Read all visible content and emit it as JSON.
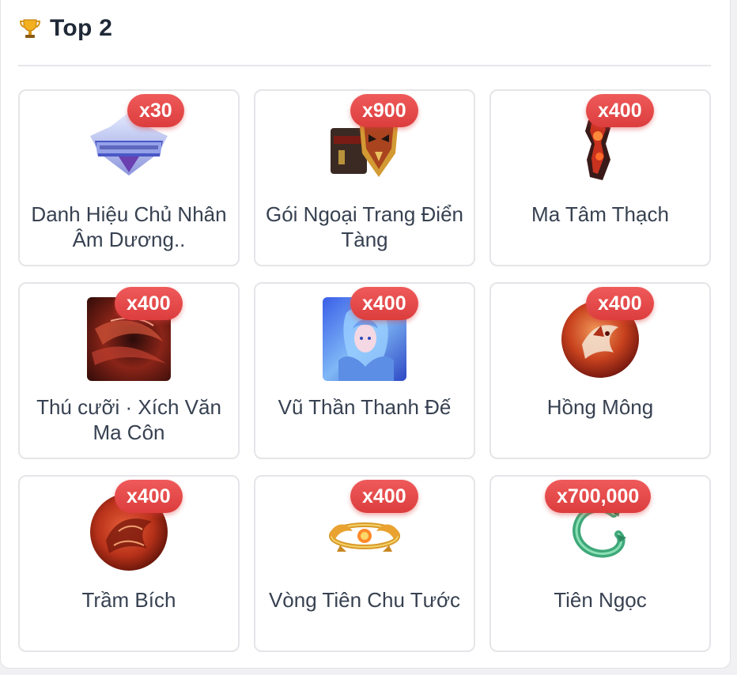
{
  "header": {
    "title": "Top 2",
    "icon": "trophy-icon"
  },
  "accent_color": "#e04848",
  "items": [
    {
      "name": "Danh Hiệu Chủ Nhân Âm Dương..",
      "qty": "x30",
      "icon": "title-badge-image"
    },
    {
      "name": "Gói Ngoại Trang Điển Tàng",
      "qty": "x900",
      "icon": "mask-chest-image"
    },
    {
      "name": "Ma Tâm Thạch",
      "qty": "x400",
      "icon": "demon-stone-image"
    },
    {
      "name": "Thú cưỡi · Xích Văn Ma Côn",
      "qty": "x400",
      "icon": "mount-image"
    },
    {
      "name": "Vũ Thần Thanh Đế",
      "qty": "x400",
      "icon": "goddess-portrait-image"
    },
    {
      "name": "Hồng Mông",
      "qty": "x400",
      "icon": "red-orb-image"
    },
    {
      "name": "Trầm Bích",
      "qty": "x400",
      "icon": "dragon-orb-image"
    },
    {
      "name": "Vòng Tiên Chu Tước",
      "qty": "x400",
      "icon": "phoenix-ring-image"
    },
    {
      "name": "Tiên Ngọc",
      "qty": "x700,000",
      "icon": "jade-dragon-image"
    }
  ]
}
